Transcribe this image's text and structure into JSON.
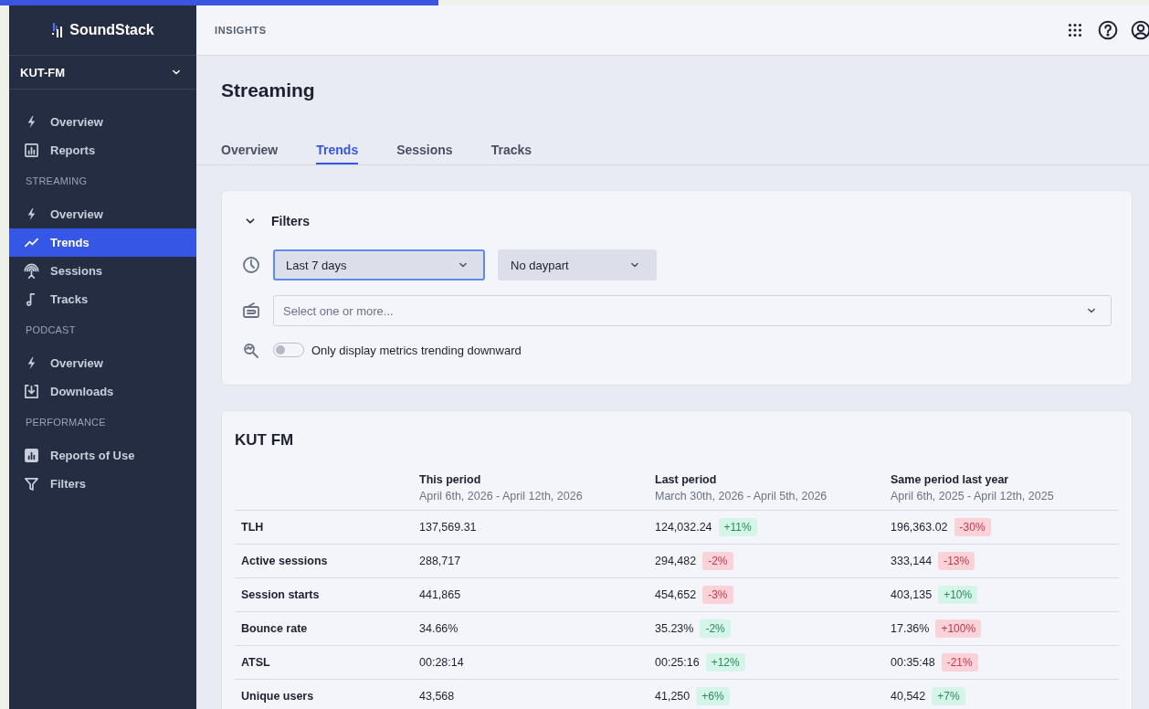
{
  "sidebar": {
    "brand": "SoundStack",
    "station": "KUT-FM",
    "sections": [
      {
        "items": [
          {
            "kind": "bolt",
            "label": "Overview",
            "selected": false
          },
          {
            "kind": "report",
            "label": "Reports",
            "selected": false
          }
        ]
      },
      {
        "heading": "STREAMING",
        "items": [
          {
            "kind": "bolt",
            "label": "Overview",
            "selected": false
          },
          {
            "kind": "trend",
            "label": "Trends",
            "selected": true
          },
          {
            "kind": "antenna",
            "label": "Sessions",
            "selected": false
          },
          {
            "kind": "note",
            "label": "Tracks",
            "selected": false
          }
        ]
      },
      {
        "heading": "PODCAST",
        "items": [
          {
            "kind": "bolt",
            "label": "Overview",
            "selected": false
          },
          {
            "kind": "download",
            "label": "Downloads",
            "selected": false
          }
        ]
      },
      {
        "heading": "PERFORMANCE",
        "items": [
          {
            "kind": "reportfill",
            "label": "Reports of Use",
            "selected": false
          },
          {
            "kind": "filter",
            "label": "Filters",
            "selected": false
          }
        ]
      }
    ]
  },
  "header": {
    "breadcrumb": "INSIGHTS"
  },
  "page": {
    "title": "Streaming",
    "tabs": [
      {
        "label": "Overview",
        "selected": false
      },
      {
        "label": "Trends",
        "selected": true
      },
      {
        "label": "Sessions",
        "selected": false
      },
      {
        "label": "Tracks",
        "selected": false
      }
    ]
  },
  "filters": {
    "title": "Filters",
    "expanded": true,
    "period": {
      "value": "Last 7 days",
      "focused": true
    },
    "daypart": {
      "value": "No daypart"
    },
    "streams": {
      "placeholder": "Select one or more..."
    },
    "downward": {
      "label": "Only display metrics trending downward",
      "on": false
    }
  },
  "table": {
    "title": "KUT FM",
    "columns": [
      {
        "label": "This period",
        "range": "April 6th, 2026 - April 12th, 2026"
      },
      {
        "label": "Last period",
        "range": "March 30th, 2026 - April 5th, 2026"
      },
      {
        "label": "Same period last year",
        "range": "April 6th, 2025 - April 12th, 2025"
      }
    ],
    "rows": [
      {
        "metric": "TLH",
        "cells": [
          {
            "value": "137,569.31"
          },
          {
            "value": "124,032.24",
            "change": "+11%",
            "kind": "good"
          },
          {
            "value": "196,363.02",
            "change": "-30%",
            "kind": "bad"
          }
        ]
      },
      {
        "metric": "Active sessions",
        "cells": [
          {
            "value": "288,717"
          },
          {
            "value": "294,482",
            "change": "-2%",
            "kind": "bad"
          },
          {
            "value": "333,144",
            "change": "-13%",
            "kind": "bad"
          }
        ]
      },
      {
        "metric": "Session starts",
        "cells": [
          {
            "value": "441,865"
          },
          {
            "value": "454,652",
            "change": "-3%",
            "kind": "bad"
          },
          {
            "value": "403,135",
            "change": "+10%",
            "kind": "good"
          }
        ]
      },
      {
        "metric": "Bounce rate",
        "cells": [
          {
            "value": "34.66%"
          },
          {
            "value": "35.23%",
            "change": "-2%",
            "kind": "good"
          },
          {
            "value": "17.36%",
            "change": "+100%",
            "kind": "bad"
          }
        ]
      },
      {
        "metric": "ATSL",
        "cells": [
          {
            "value": "00:28:14"
          },
          {
            "value": "00:25:16",
            "change": "+12%",
            "kind": "good"
          },
          {
            "value": "00:35:48",
            "change": "-21%",
            "kind": "bad"
          }
        ]
      },
      {
        "metric": "Unique users",
        "cells": [
          {
            "value": "43,568"
          },
          {
            "value": "41,250",
            "change": "+6%",
            "kind": "good"
          },
          {
            "value": "40,542",
            "change": "+7%",
            "kind": "good"
          }
        ]
      }
    ]
  }
}
